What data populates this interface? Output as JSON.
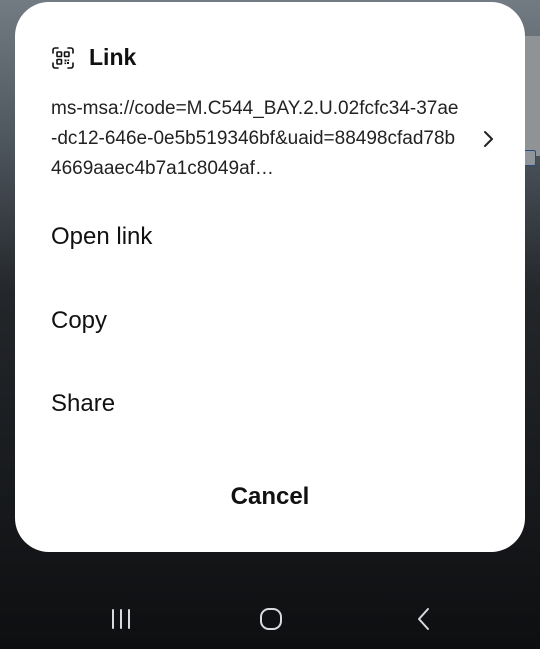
{
  "sheet": {
    "title": "Link",
    "title_icon": "qr-code-icon",
    "url": "ms-msa://code=M.C544_BAY.2.U.02fcfc34-37ae-dc12-646e-0e5b519346bf&uaid=88498cfad78b4669aaec4b7a1c8049af…",
    "url_chevron_icon": "chevron-right-icon",
    "actions": {
      "open_link": "Open link",
      "copy": "Copy",
      "share": "Share"
    },
    "cancel_label": "Cancel"
  },
  "navbar": {
    "recents_icon": "recents-icon",
    "home_icon": "home-icon",
    "back_icon": "back-icon"
  },
  "colors": {
    "sheet_background": "#ffffff",
    "text_primary": "#111111",
    "scrim": "rgba(0,0,0,0.38)"
  }
}
